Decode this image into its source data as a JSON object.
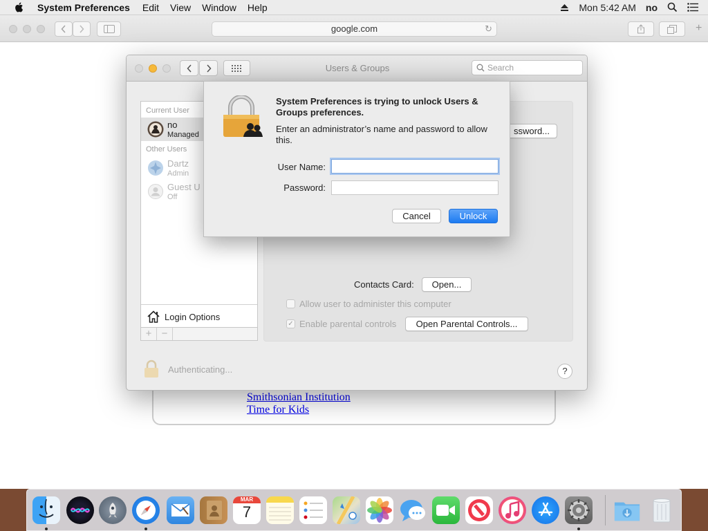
{
  "menubar": {
    "app_name": "System Preferences",
    "menus": [
      "Edit",
      "View",
      "Window",
      "Help"
    ],
    "clock": "Mon 5:42 AM",
    "user": "no"
  },
  "safari": {
    "url": "google.com",
    "links": [
      "Smithsonian Institution",
      "Time for Kids"
    ]
  },
  "sp_window": {
    "title": "Users & Groups",
    "search_placeholder": "Search",
    "current_user_heading": "Current User",
    "other_users_heading": "Other Users",
    "users": [
      {
        "name": "no",
        "subtitle": "Managed"
      },
      {
        "name": "Dartz",
        "subtitle": "Admin"
      },
      {
        "name": "Guest U",
        "subtitle": "Off"
      }
    ],
    "login_options": "Login Options",
    "add_label": "+",
    "remove_label": "−",
    "password_button": "ssword...",
    "contacts_card_label": "Contacts Card:",
    "open_button": "Open...",
    "allow_admin_label": "Allow user to administer this computer",
    "parental_controls_label": "Enable parental controls",
    "open_parental_button": "Open Parental Controls...",
    "authenticating": "Authenticating...",
    "help": "?"
  },
  "auth_dialog": {
    "heading": "System Preferences is trying to unlock Users & Groups preferences.",
    "description": "Enter an administrator’s name and password to allow this.",
    "username_label": "User Name:",
    "username_value": "",
    "password_label": "Password:",
    "password_value": "",
    "cancel": "Cancel",
    "unlock": "Unlock"
  },
  "dock": {
    "items": [
      "Finder",
      "Siri",
      "Launchpad",
      "Safari",
      "Mail",
      "Contacts",
      "Calendar",
      "Notes",
      "Reminders",
      "Maps",
      "Photos",
      "Messages",
      "FaceTime",
      "News",
      "iTunes",
      "App Store",
      "System Preferences",
      "Downloads",
      "Trash"
    ],
    "calendar_month": "MAR",
    "calendar_day": "7"
  }
}
